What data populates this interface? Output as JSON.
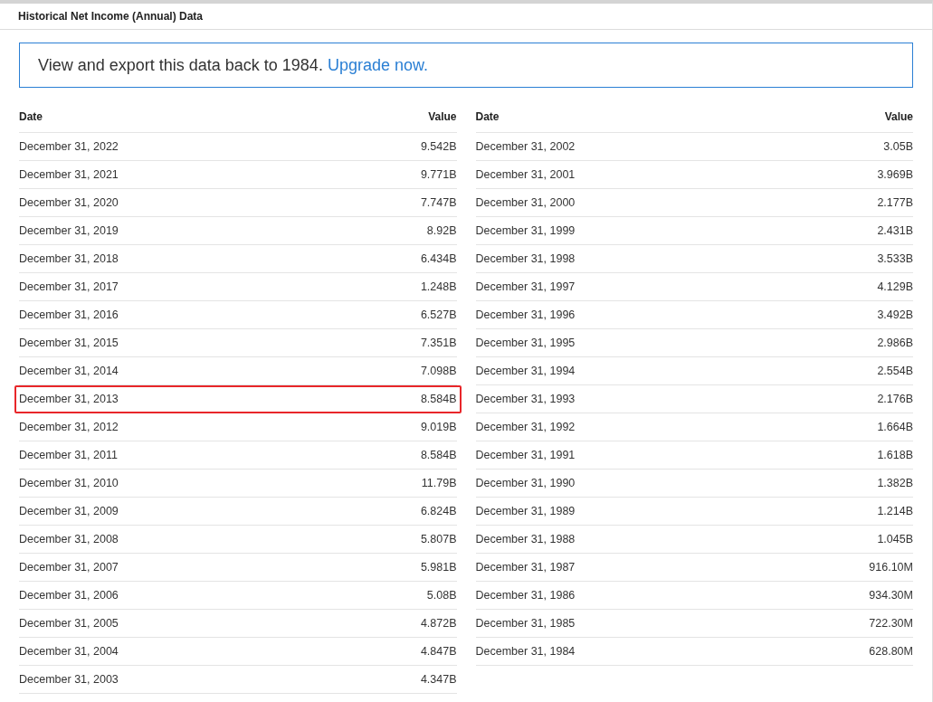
{
  "title": "Historical Net Income (Annual) Data",
  "banner": {
    "text": "View and export this data back to 1984.",
    "link": "Upgrade now."
  },
  "tables": [
    {
      "columns": [
        "Date",
        "Value"
      ],
      "rows": [
        {
          "date": "December 31, 2022",
          "value": "9.542B",
          "selected": false
        },
        {
          "date": "December 31, 2021",
          "value": "9.771B",
          "selected": false
        },
        {
          "date": "December 31, 2020",
          "value": "7.747B",
          "selected": false
        },
        {
          "date": "December 31, 2019",
          "value": "8.92B",
          "selected": false
        },
        {
          "date": "December 31, 2018",
          "value": "6.434B",
          "selected": false
        },
        {
          "date": "December 31, 2017",
          "value": "1.248B",
          "selected": false
        },
        {
          "date": "December 31, 2016",
          "value": "6.527B",
          "selected": false
        },
        {
          "date": "December 31, 2015",
          "value": "7.351B",
          "selected": false
        },
        {
          "date": "December 31, 2014",
          "value": "7.098B",
          "selected": false
        },
        {
          "date": "December 31, 2013",
          "value": "8.584B",
          "selected": true
        },
        {
          "date": "December 31, 2012",
          "value": "9.019B",
          "selected": false
        },
        {
          "date": "December 31, 2011",
          "value": "8.584B",
          "selected": false
        },
        {
          "date": "December 31, 2010",
          "value": "11.79B",
          "selected": false
        },
        {
          "date": "December 31, 2009",
          "value": "6.824B",
          "selected": false
        },
        {
          "date": "December 31, 2008",
          "value": "5.807B",
          "selected": false
        },
        {
          "date": "December 31, 2007",
          "value": "5.981B",
          "selected": false
        },
        {
          "date": "December 31, 2006",
          "value": "5.08B",
          "selected": false
        },
        {
          "date": "December 31, 2005",
          "value": "4.872B",
          "selected": false
        },
        {
          "date": "December 31, 2004",
          "value": "4.847B",
          "selected": false
        },
        {
          "date": "December 31, 2003",
          "value": "4.347B",
          "selected": false
        }
      ]
    },
    {
      "columns": [
        "Date",
        "Value"
      ],
      "rows": [
        {
          "date": "December 31, 2002",
          "value": "3.05B",
          "selected": false
        },
        {
          "date": "December 31, 2001",
          "value": "3.969B",
          "selected": false
        },
        {
          "date": "December 31, 2000",
          "value": "2.177B",
          "selected": false
        },
        {
          "date": "December 31, 1999",
          "value": "2.431B",
          "selected": false
        },
        {
          "date": "December 31, 1998",
          "value": "3.533B",
          "selected": false
        },
        {
          "date": "December 31, 1997",
          "value": "4.129B",
          "selected": false
        },
        {
          "date": "December 31, 1996",
          "value": "3.492B",
          "selected": false
        },
        {
          "date": "December 31, 1995",
          "value": "2.986B",
          "selected": false
        },
        {
          "date": "December 31, 1994",
          "value": "2.554B",
          "selected": false
        },
        {
          "date": "December 31, 1993",
          "value": "2.176B",
          "selected": false
        },
        {
          "date": "December 31, 1992",
          "value": "1.664B",
          "selected": false
        },
        {
          "date": "December 31, 1991",
          "value": "1.618B",
          "selected": false
        },
        {
          "date": "December 31, 1990",
          "value": "1.382B",
          "selected": false
        },
        {
          "date": "December 31, 1989",
          "value": "1.214B",
          "selected": false
        },
        {
          "date": "December 31, 1988",
          "value": "1.045B",
          "selected": false
        },
        {
          "date": "December 31, 1987",
          "value": "916.10M",
          "selected": false
        },
        {
          "date": "December 31, 1986",
          "value": "934.30M",
          "selected": false
        },
        {
          "date": "December 31, 1985",
          "value": "722.30M",
          "selected": false
        },
        {
          "date": "December 31, 1984",
          "value": "628.80M",
          "selected": false
        }
      ]
    }
  ]
}
